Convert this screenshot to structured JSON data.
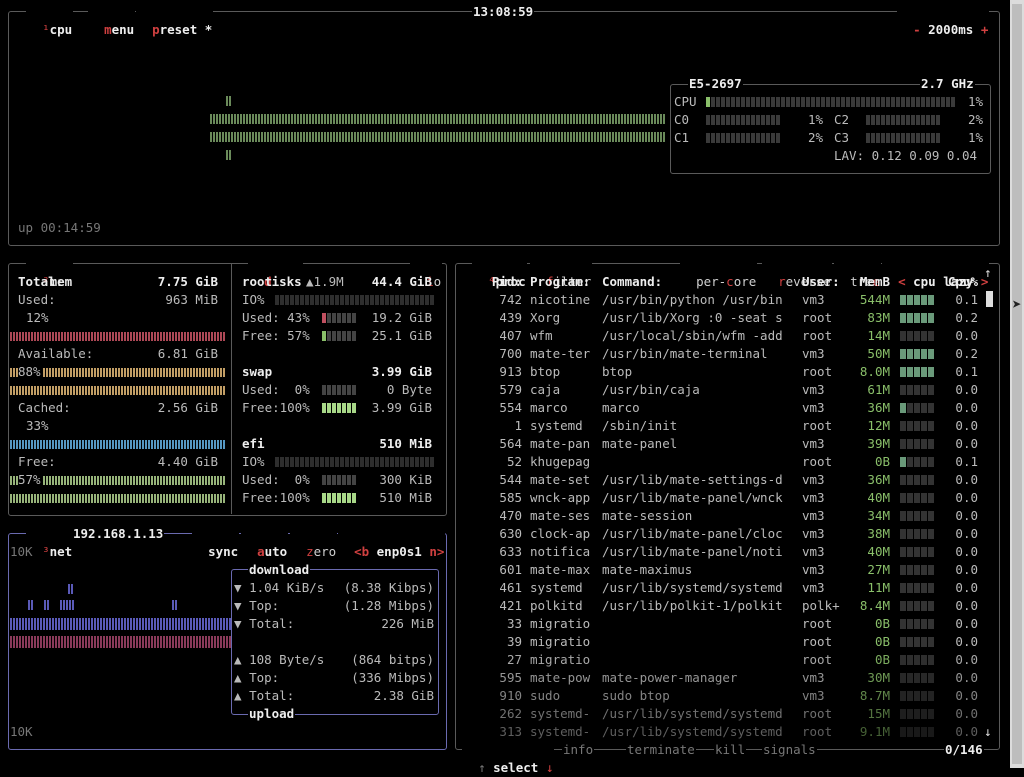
{
  "cpu_box": {
    "sup": "¹",
    "title": "cpu",
    "menu": "menu",
    "preset": "preset *",
    "clock": "13:08:59",
    "interval_minus": "-",
    "interval": "2000ms",
    "interval_plus": "+",
    "uptime": "up 00:14:59",
    "model": "E5-2697",
    "freq": "2.7 GHz",
    "total_label": "CPU",
    "total_pct": "1%",
    "cores": [
      {
        "label": "C0",
        "pct": "1%",
        "level": 0.01
      },
      {
        "label": "C1",
        "pct": "2%",
        "level": 0.02
      },
      {
        "label": "C2",
        "pct": "2%",
        "level": 0.02
      },
      {
        "label": "C3",
        "pct": "1%",
        "level": 0.01
      }
    ],
    "lav_label": "LAV:",
    "lav": "0.12 0.09 0.04"
  },
  "mem_box": {
    "sup": "²",
    "title": "mem",
    "total_label": "Total:",
    "total": "7.75 GiB",
    "used_label": "Used:",
    "used": "963 MiB",
    "used_pct": "12%",
    "avail_label": "Available:",
    "avail": "6.81 GiB",
    "avail_pct": "88%",
    "cached_label": "Cached:",
    "cached": "2.56 GiB",
    "cached_pct": "33%",
    "free_label": "Free:",
    "free": "4.40 GiB",
    "free_pct": "57%",
    "colors": {
      "used": "#c05060",
      "avail": "#d8b070",
      "cached": "#60a8d8",
      "free": "#a8c888"
    }
  },
  "disks_box": {
    "title_d": "d",
    "title_rest": "isks",
    "io": "io",
    "root_name": "root",
    "root_speed": "▲1.9M",
    "root_size": "44.4 GiB",
    "root_io_label": "IO%",
    "root_used_label": "Used: 43%",
    "root_used": "19.2 GiB",
    "root_free_label": "Free: 57%",
    "root_free": "25.1 GiB",
    "swap_name": "swap",
    "swap_size": "3.99 GiB",
    "swap_used_label": "Used:  0%",
    "swap_used": "0 Byte",
    "swap_free_label": "Free:100%",
    "swap_free": "3.99 GiB",
    "efi_name": "efi",
    "efi_size": "510 MiB",
    "efi_io_label": "IO%",
    "efi_used_label": "Used:  0%",
    "efi_used": "300 KiB",
    "efi_free_label": "Free:100%",
    "efi_free": "510 MiB"
  },
  "net_box": {
    "sup": "³",
    "title": "net",
    "ip": "192.168.1.13",
    "sync": "sync",
    "auto": "auto",
    "zero": "zero",
    "prev": "<b",
    "iface": "enp0s1",
    "next": "n>",
    "scale_top": "10K",
    "scale_bottom": "10K",
    "download_title": "download",
    "dl_rate": "1.04 KiB/s",
    "dl_rate_bits": "(8.38 Kibps)",
    "dl_top_label": "Top:",
    "dl_top": "(1.28 Mibps)",
    "dl_total_label": "Total:",
    "dl_total": "226 MiB",
    "ul_rate": "108 Byte/s",
    "ul_rate_bits": "(864 bitps)",
    "ul_top_label": "Top:",
    "ul_top": "(336 Mibps)",
    "ul_total_label": "Total:",
    "ul_total": "2.38 GiB",
    "upload_title": "upload",
    "down_arrow": "▼",
    "up_arrow": "▲"
  },
  "proc_box": {
    "sup": "⁴",
    "title": "proc",
    "filter": "filter",
    "per_core": "per-core",
    "reverse": "reverse",
    "tree": "tree",
    "sort_prev": "<",
    "sort": "cpu lazy",
    "sort_next": ">",
    "headers": {
      "pid": "Pid:",
      "program": "Program:",
      "command": "Command:",
      "user": "User:",
      "mem": "MemB",
      "cpu": "Cpu%"
    },
    "rows": [
      {
        "pid": "742",
        "program": "nicotine",
        "command": "/usr/bin/python /usr/bin",
        "user": "vm3",
        "mem": "544M",
        "cpu": "0.1",
        "g": 5
      },
      {
        "pid": "439",
        "program": "Xorg",
        "command": "/usr/lib/Xorg :0 -seat s",
        "user": "root",
        "mem": "83M",
        "cpu": "0.2",
        "g": 5
      },
      {
        "pid": "407",
        "program": "wfm",
        "command": "/usr/local/sbin/wfm -add",
        "user": "root",
        "mem": "14M",
        "cpu": "0.0",
        "g": 0
      },
      {
        "pid": "700",
        "program": "mate-ter",
        "command": "/usr/bin/mate-terminal",
        "user": "vm3",
        "mem": "50M",
        "cpu": "0.2",
        "g": 5
      },
      {
        "pid": "913",
        "program": "btop",
        "command": "btop",
        "user": "root",
        "mem": "8.0M",
        "cpu": "0.1",
        "g": 5
      },
      {
        "pid": "579",
        "program": "caja",
        "command": "/usr/bin/caja",
        "user": "vm3",
        "mem": "61M",
        "cpu": "0.0",
        "g": 0
      },
      {
        "pid": "554",
        "program": "marco",
        "command": "marco",
        "user": "vm3",
        "mem": "36M",
        "cpu": "0.0",
        "g": 1
      },
      {
        "pid": "1",
        "program": "systemd",
        "command": "/sbin/init",
        "user": "root",
        "mem": "12M",
        "cpu": "0.0",
        "g": 0
      },
      {
        "pid": "564",
        "program": "mate-pan",
        "command": "mate-panel",
        "user": "vm3",
        "mem": "39M",
        "cpu": "0.0",
        "g": 0
      },
      {
        "pid": "52",
        "program": "khugepag",
        "command": "",
        "user": "root",
        "mem": "0B",
        "cpu": "0.1",
        "g": 1
      },
      {
        "pid": "544",
        "program": "mate-set",
        "command": "/usr/lib/mate-settings-d",
        "user": "vm3",
        "mem": "36M",
        "cpu": "0.0",
        "g": 0
      },
      {
        "pid": "585",
        "program": "wnck-app",
        "command": "/usr/lib/mate-panel/wnck",
        "user": "vm3",
        "mem": "40M",
        "cpu": "0.0",
        "g": 0
      },
      {
        "pid": "470",
        "program": "mate-ses",
        "command": "mate-session",
        "user": "vm3",
        "mem": "34M",
        "cpu": "0.0",
        "g": 0
      },
      {
        "pid": "630",
        "program": "clock-ap",
        "command": "/usr/lib/mate-panel/cloc",
        "user": "vm3",
        "mem": "38M",
        "cpu": "0.0",
        "g": 0
      },
      {
        "pid": "633",
        "program": "notifica",
        "command": "/usr/lib/mate-panel/noti",
        "user": "vm3",
        "mem": "40M",
        "cpu": "0.0",
        "g": 0
      },
      {
        "pid": "601",
        "program": "mate-max",
        "command": "mate-maximus",
        "user": "vm3",
        "mem": "27M",
        "cpu": "0.0",
        "g": 0
      },
      {
        "pid": "461",
        "program": "systemd",
        "command": "/usr/lib/systemd/systemd",
        "user": "vm3",
        "mem": "11M",
        "cpu": "0.0",
        "g": 0
      },
      {
        "pid": "421",
        "program": "polkitd",
        "command": "/usr/lib/polkit-1/polkit",
        "user": "polk+",
        "mem": "8.4M",
        "cpu": "0.0",
        "g": 0
      },
      {
        "pid": "33",
        "program": "migratio",
        "command": "",
        "user": "root",
        "mem": "0B",
        "cpu": "0.0",
        "g": 0
      },
      {
        "pid": "39",
        "program": "migratio",
        "command": "",
        "user": "root",
        "mem": "0B",
        "cpu": "0.0",
        "g": 0
      },
      {
        "pid": "27",
        "program": "migratio",
        "command": "",
        "user": "root",
        "mem": "0B",
        "cpu": "0.0",
        "g": 0
      },
      {
        "pid": "595",
        "program": "mate-pow",
        "command": "mate-power-manager",
        "user": "vm3",
        "mem": "30M",
        "cpu": "0.0",
        "g": 0
      },
      {
        "pid": "910",
        "program": "sudo",
        "command": "sudo btop",
        "user": "vm3",
        "mem": "8.7M",
        "cpu": "0.0",
        "g": 0
      },
      {
        "pid": "262",
        "program": "systemd-",
        "command": "/usr/lib/systemd/systemd",
        "user": "root",
        "mem": "15M",
        "cpu": "0.0",
        "g": 0
      },
      {
        "pid": "313",
        "program": "systemd-",
        "command": "/usr/lib/systemd/systemd",
        "user": "root",
        "mem": "9.1M",
        "cpu": "0.0",
        "g": 0
      }
    ],
    "footer": {
      "up_arrow": "↑",
      "select": "select",
      "down_arrow": "↓",
      "info": "info",
      "terminate": "terminate",
      "kill": "kill",
      "signals": "signals",
      "count": "0/146"
    }
  }
}
